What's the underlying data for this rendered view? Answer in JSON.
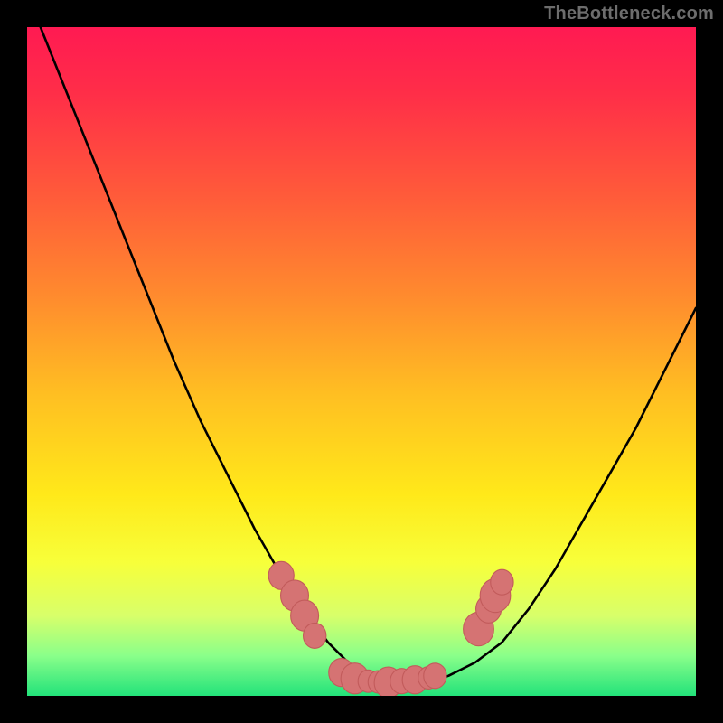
{
  "watermark": "TheBottleneck.com",
  "colors": {
    "black": "#000000",
    "curve": "#000000",
    "marker_fill": "#d57373",
    "marker_stroke": "#c25b5b",
    "gradient_stops": [
      {
        "offset": 0.0,
        "color": "#ff1a52"
      },
      {
        "offset": 0.1,
        "color": "#ff2e48"
      },
      {
        "offset": 0.25,
        "color": "#ff5a3a"
      },
      {
        "offset": 0.4,
        "color": "#ff8a2e"
      },
      {
        "offset": 0.55,
        "color": "#ffbf22"
      },
      {
        "offset": 0.7,
        "color": "#ffe91a"
      },
      {
        "offset": 0.8,
        "color": "#f7ff3a"
      },
      {
        "offset": 0.88,
        "color": "#d8ff6a"
      },
      {
        "offset": 0.94,
        "color": "#8aff8a"
      },
      {
        "offset": 1.0,
        "color": "#22e27a"
      }
    ]
  },
  "chart_data": {
    "type": "line",
    "title": "",
    "xlabel": "",
    "ylabel": "",
    "xlim": [
      0,
      100
    ],
    "ylim": [
      0,
      100
    ],
    "series": [
      {
        "name": "bottleneck-curve",
        "x": [
          2,
          6,
          10,
          14,
          18,
          22,
          26,
          30,
          34,
          38,
          42,
          45,
          48,
          51,
          54,
          57,
          60,
          63,
          67,
          71,
          75,
          79,
          83,
          87,
          91,
          95,
          100
        ],
        "y": [
          100,
          90,
          80,
          70,
          60,
          50,
          41,
          33,
          25,
          18,
          12,
          8,
          5,
          3,
          2,
          2,
          2,
          3,
          5,
          8,
          13,
          19,
          26,
          33,
          40,
          48,
          58
        ]
      }
    ],
    "markers": [
      {
        "x": 38,
        "y": 18,
        "r": 2.0
      },
      {
        "x": 40,
        "y": 15,
        "r": 2.2
      },
      {
        "x": 41.5,
        "y": 12,
        "r": 2.2
      },
      {
        "x": 43,
        "y": 9,
        "r": 1.8
      },
      {
        "x": 47,
        "y": 3.5,
        "r": 2.0
      },
      {
        "x": 49,
        "y": 2.6,
        "r": 2.2
      },
      {
        "x": 51,
        "y": 2.2,
        "r": 1.6
      },
      {
        "x": 52.5,
        "y": 2.1,
        "r": 1.6
      },
      {
        "x": 54,
        "y": 2.0,
        "r": 2.2
      },
      {
        "x": 56,
        "y": 2.2,
        "r": 1.8
      },
      {
        "x": 58,
        "y": 2.4,
        "r": 2.0
      },
      {
        "x": 60,
        "y": 2.7,
        "r": 1.6
      },
      {
        "x": 61,
        "y": 3.0,
        "r": 1.8
      },
      {
        "x": 67.5,
        "y": 10,
        "r": 2.4
      },
      {
        "x": 69,
        "y": 13,
        "r": 2.0
      },
      {
        "x": 70,
        "y": 15,
        "r": 2.4
      },
      {
        "x": 71,
        "y": 17,
        "r": 1.8
      }
    ]
  }
}
